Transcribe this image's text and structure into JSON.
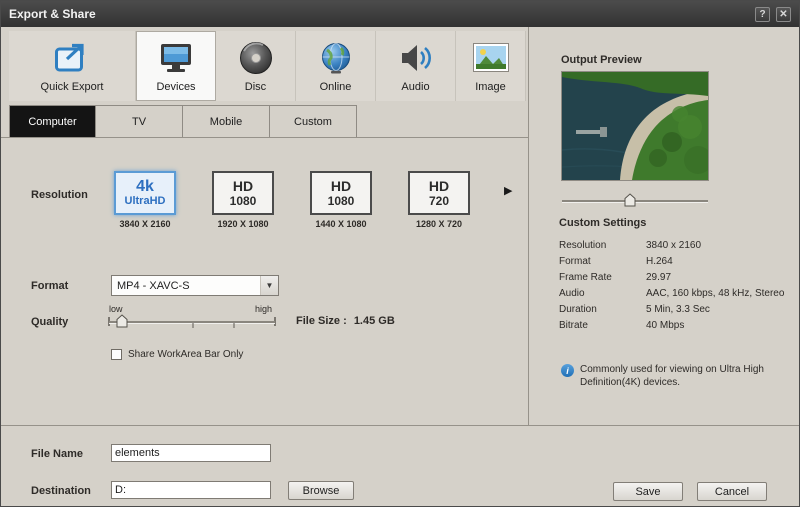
{
  "titlebar": {
    "title": "Export & Share"
  },
  "icons": {
    "help": "?",
    "close": "✕",
    "dropdown_arrow": "▼",
    "scroll_right": "▶",
    "info": "i"
  },
  "top_tabs": [
    {
      "label": "Quick Export",
      "selected": false
    },
    {
      "label": "Devices",
      "selected": true
    },
    {
      "label": "Disc",
      "selected": false
    },
    {
      "label": "Online",
      "selected": false
    },
    {
      "label": "Audio",
      "selected": false
    },
    {
      "label": "Image",
      "selected": false
    }
  ],
  "device_tabs": [
    {
      "label": "Computer",
      "selected": true
    },
    {
      "label": "TV",
      "selected": false
    },
    {
      "label": "Mobile",
      "selected": false
    },
    {
      "label": "Custom",
      "selected": false
    }
  ],
  "resolution": {
    "label": "Resolution",
    "options": [
      {
        "line1": "4k",
        "line2": "UltraHD",
        "subtitle": "3840 X 2160",
        "selected": true
      },
      {
        "line1": "HD",
        "line2": "1080",
        "subtitle": "1920 X 1080",
        "selected": false
      },
      {
        "line1": "HD",
        "line2": "1080",
        "subtitle": "1440 X 1080",
        "selected": false
      },
      {
        "line1": "HD",
        "line2": "720",
        "subtitle": "1280 X 720",
        "selected": false
      }
    ]
  },
  "format": {
    "label": "Format",
    "value": "MP4 - XAVC-S"
  },
  "quality": {
    "label": "Quality",
    "min_label": "low",
    "max_label": "high",
    "value_percent": 8
  },
  "file_size": {
    "label": "File Size :",
    "value": "1.45 GB"
  },
  "share_workarea": {
    "label": "Share WorkArea Bar Only",
    "checked": false
  },
  "output_preview": {
    "title": "Output Preview",
    "slider_percent": 47
  },
  "custom_settings": {
    "title": "Custom Settings",
    "rows": [
      {
        "key": "Resolution",
        "value": "3840 x 2160"
      },
      {
        "key": "Format",
        "value": "H.264"
      },
      {
        "key": "Frame Rate",
        "value": "29.97"
      },
      {
        "key": "Audio",
        "value": "AAC, 160 kbps, 48 kHz, Stereo"
      },
      {
        "key": "Duration",
        "value": "5 Min, 3.3 Sec"
      },
      {
        "key": "Bitrate",
        "value": "40 Mbps"
      }
    ],
    "note": "Commonly used for viewing on Ultra High Definition(4K) devices."
  },
  "footer": {
    "file_name_label": "File Name",
    "file_name_value": "elements",
    "destination_label": "Destination",
    "destination_value": "D:",
    "browse_label": "Browse",
    "save_label": "Save",
    "cancel_label": "Cancel"
  },
  "colors": {
    "accent_blue": "#3b82c4",
    "selected_card_border": "#5b9bd5",
    "selected_device_tab_bg": "#141414",
    "dialog_bg": "#d5d1c9"
  }
}
